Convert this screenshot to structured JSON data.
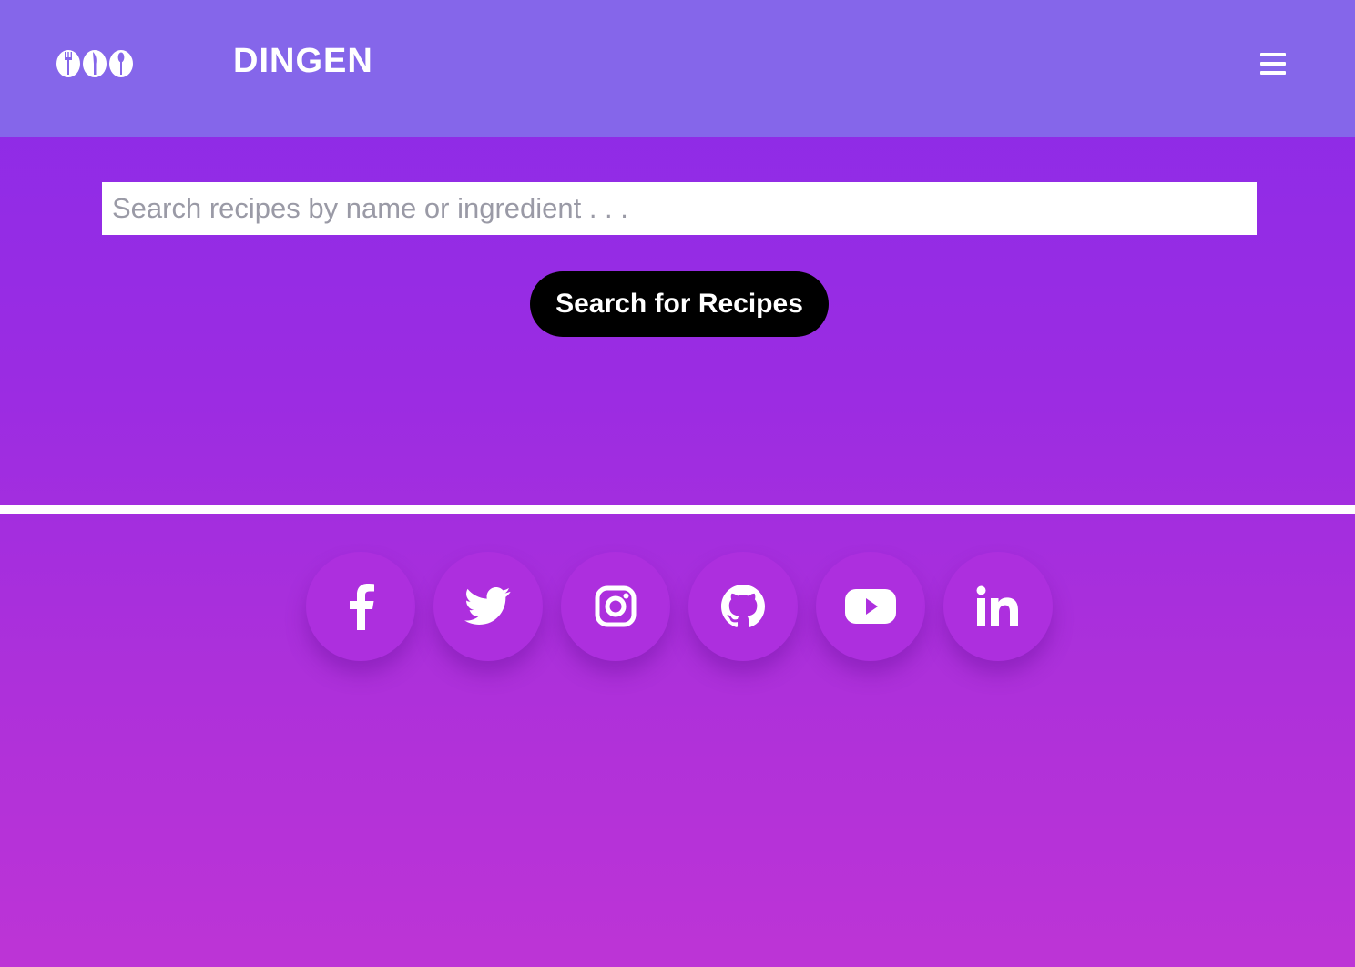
{
  "header": {
    "brand": "DINGEN",
    "logo_icon": "cutlery-plates-logo",
    "menu_icon": "hamburger-menu-icon"
  },
  "search": {
    "placeholder": "Search recipes by name or ingredient . . .",
    "value": "",
    "button_label": "Search for Recipes"
  },
  "social": [
    {
      "name": "facebook",
      "icon": "facebook-icon"
    },
    {
      "name": "twitter",
      "icon": "twitter-icon"
    },
    {
      "name": "instagram",
      "icon": "instagram-icon"
    },
    {
      "name": "github",
      "icon": "github-icon"
    },
    {
      "name": "youtube",
      "icon": "youtube-icon"
    },
    {
      "name": "linkedin",
      "icon": "linkedin-icon"
    }
  ],
  "colors": {
    "navbar": "#8566ea",
    "background_top": "#8a2be9",
    "background_bottom": "#bd34d6",
    "social_circle": "#ad2fde",
    "button": "#000000",
    "text_light": "#ffffff"
  }
}
